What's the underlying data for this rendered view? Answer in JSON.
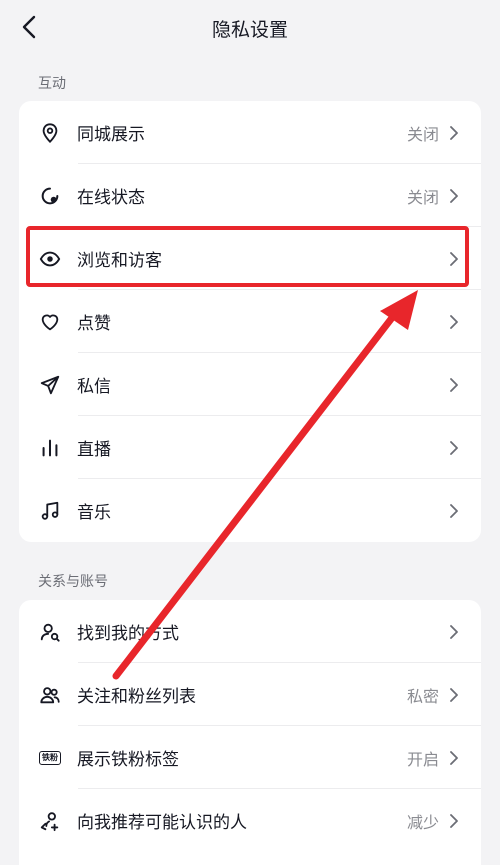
{
  "header": {
    "title": "隐私设置",
    "back_icon": "chevron-left-icon"
  },
  "sections": [
    {
      "label": "互动",
      "items": [
        {
          "label": "同城展示",
          "value": "关闭",
          "icon": "location-pin-icon"
        },
        {
          "label": "在线状态",
          "value": "关闭",
          "icon": "online-status-icon"
        },
        {
          "label": "浏览和访客",
          "value": "",
          "icon": "eye-icon"
        },
        {
          "label": "点赞",
          "value": "",
          "icon": "heart-icon"
        },
        {
          "label": "私信",
          "value": "",
          "icon": "paper-plane-icon"
        },
        {
          "label": "直播",
          "value": "",
          "icon": "live-bars-icon"
        },
        {
          "label": "音乐",
          "value": "",
          "icon": "music-note-icon"
        }
      ]
    },
    {
      "label": "关系与账号",
      "items": [
        {
          "label": "找到我的方式",
          "value": "",
          "icon": "person-search-icon"
        },
        {
          "label": "关注和粉丝列表",
          "value": "私密",
          "icon": "people-icon"
        },
        {
          "label": "展示铁粉标签",
          "value": "开启",
          "icon": "fan-badge-icon",
          "badge_text": "铁粉"
        },
        {
          "label": "向我推荐可能认识的人",
          "value": "减少",
          "icon": "person-recommend-icon"
        }
      ]
    }
  ],
  "annotation": {
    "highlight_color": "#e8262b",
    "arrow_color": "#e8262b"
  },
  "colors": {
    "background": "#f3f3f5",
    "card": "#ffffff",
    "text": "#161823",
    "secondary": "#8a8b91"
  }
}
